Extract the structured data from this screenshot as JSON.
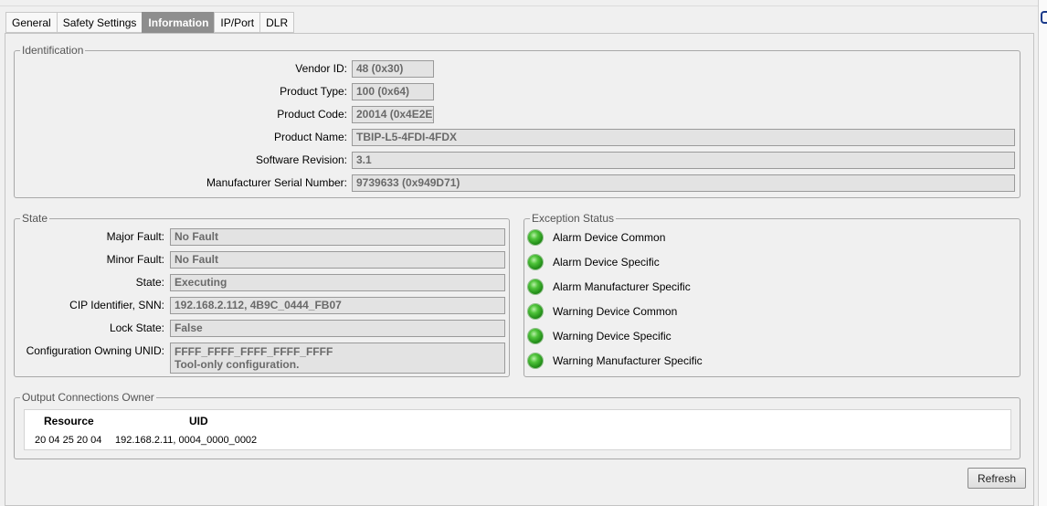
{
  "tabs": [
    {
      "label": "General"
    },
    {
      "label": "Safety Settings"
    },
    {
      "label": "Information",
      "active": true
    },
    {
      "label": "IP/Port"
    },
    {
      "label": "DLR"
    }
  ],
  "identification": {
    "legend": "Identification",
    "fields": [
      {
        "label": "Vendor ID:",
        "value": "48 (0x30)"
      },
      {
        "label": "Product Type:",
        "value": "100 (0x64)"
      },
      {
        "label": "Product Code:",
        "value": "20014 (0x4E2E)"
      },
      {
        "label": "Product Name:",
        "value": "TBIP-L5-4FDI-4FDX"
      },
      {
        "label": "Software Revision:",
        "value": "3.1"
      },
      {
        "label": "Manufacturer Serial Number:",
        "value": "9739633 (0x949D71)"
      }
    ]
  },
  "state": {
    "legend": "State",
    "fields": [
      {
        "label": "Major Fault:",
        "value": "No Fault"
      },
      {
        "label": "Minor Fault:",
        "value": "No Fault"
      },
      {
        "label": "State:",
        "value": "Executing"
      },
      {
        "label": "CIP Identifier, SNN:",
        "value": "192.168.2.112, 4B9C_0444_FB07"
      },
      {
        "label": "Lock State:",
        "value": "False"
      },
      {
        "label": "Configuration Owning UNID:",
        "value": "FFFF_FFFF_FFFF_FFFF_FFFF",
        "value2": "Tool-only configuration."
      }
    ]
  },
  "exception_status": {
    "legend": "Exception Status",
    "indicator_color": "#2e9e22",
    "items": [
      {
        "label": "Alarm Device Common"
      },
      {
        "label": "Alarm Device Specific"
      },
      {
        "label": "Alarm Manufacturer Specific"
      },
      {
        "label": "Warning Device Common"
      },
      {
        "label": "Warning Device Specific"
      },
      {
        "label": "Warning Manufacturer Specific"
      }
    ]
  },
  "output_connections": {
    "legend": "Output Connections Owner",
    "columns": [
      "Resource",
      "UID"
    ],
    "rows": [
      {
        "resource": "20 04 25 20 04",
        "uid": "192.168.2.11, 0004_0000_0002"
      }
    ]
  },
  "refresh_label": "Refresh",
  "colors": {
    "active_tab_bg": "#8e8e8e",
    "readonly_field_bg": "#e3e3e3",
    "panel_bg": "#f0f0f0"
  }
}
